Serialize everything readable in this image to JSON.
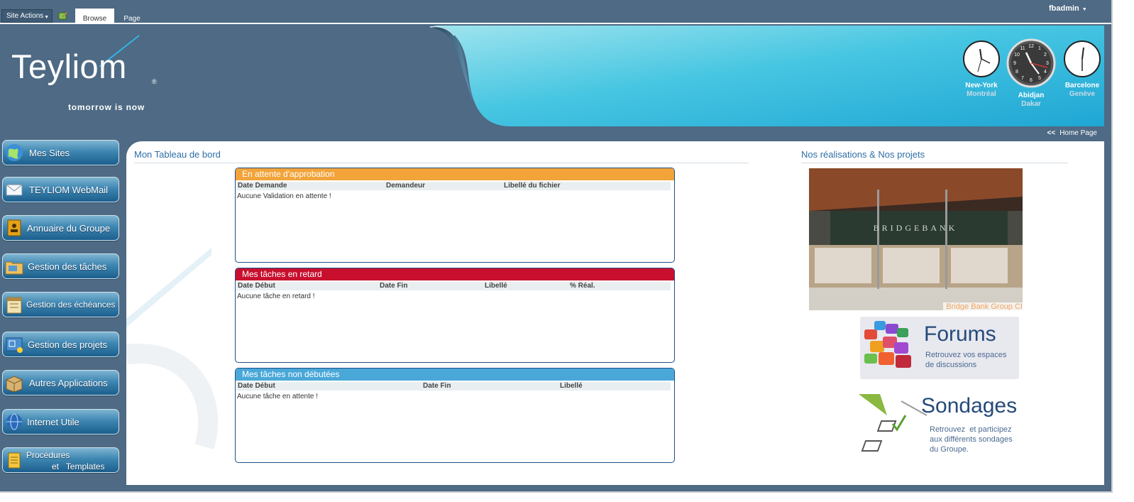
{
  "ribbon": {
    "site_actions": "Site Actions",
    "tab_browse": "Browse",
    "tab_page": "Page",
    "user": "fbadmin"
  },
  "logo": {
    "name": "Teyliom",
    "tagline": "tomorrow is now",
    "reg": "®"
  },
  "clocks": [
    {
      "city": "New-York",
      "city2": "Montréal"
    },
    {
      "city": "Abidjan",
      "city2": "Dakar"
    },
    {
      "city": "Barcelone",
      "city2": "Genève"
    }
  ],
  "subbar": {
    "arrows": "<<",
    "home": "Home Page"
  },
  "nav": [
    {
      "label": "Mes Sites",
      "icon": "globe-icon"
    },
    {
      "label": "TEYLIOM WebMail",
      "icon": "mail-icon"
    },
    {
      "label": "Annuaire du Groupe",
      "icon": "address-book-icon"
    },
    {
      "label": "Gestion des tâches",
      "icon": "folder-tasks-icon"
    },
    {
      "label": "Gestion des échéances",
      "icon": "calendar-icon"
    },
    {
      "label": "Gestion des projets",
      "icon": "blueprint-icon"
    },
    {
      "label": "Autres Applications",
      "icon": "box-icon"
    },
    {
      "label": "Internet Utile",
      "icon": "internet-globe-icon"
    },
    {
      "label_line1": "Procédures",
      "label_line2": "et   Templates",
      "icon": "document-icon"
    }
  ],
  "dashboard": {
    "title": "Mon Tableau de bord",
    "panels": [
      {
        "title": "En attente d'approbation",
        "color": "#f2a33a",
        "columns": [
          "Date Demande",
          "Demandeur",
          "Libellé du fichier"
        ],
        "empty": "Aucune Validation en attente !"
      },
      {
        "title": "Mes tâches en retard",
        "color": "#c8102e",
        "columns": [
          "Date Début",
          "Date Fin",
          "Libellé",
          "% Réal."
        ],
        "empty": "Aucune tâche en retard !"
      },
      {
        "title": "Mes tâches non débutées",
        "color": "#4aa8d8",
        "columns": [
          "Date Début",
          "Date Fin",
          "Libellé"
        ],
        "empty": "Aucune tâche en attente !"
      }
    ]
  },
  "projects": {
    "title": "Nos réalisations & Nos projets",
    "photo_sign": "BRIDGEBANK",
    "photo_caption": "Bridge Bank Group CI",
    "forums": {
      "title": "Forums",
      "line1": "Retrouvez vos espaces",
      "line2": "de discussions"
    },
    "sondages": {
      "title": "Sondages",
      "line1": "Retrouvez  et participez",
      "line2": "aux différents sondages",
      "line3": "du Groupe."
    }
  }
}
